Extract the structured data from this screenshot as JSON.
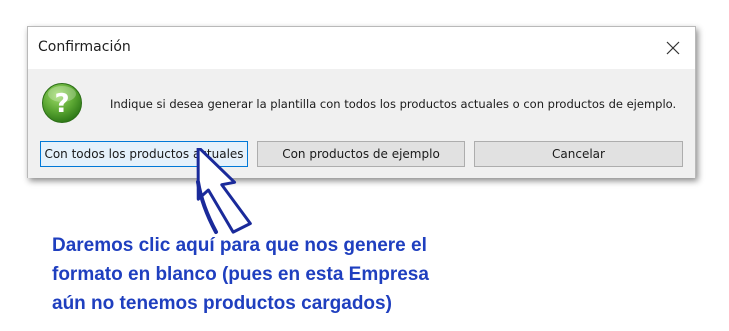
{
  "dialog": {
    "title": "Confirmación",
    "close_icon": "close-icon",
    "question_icon": "question-mark-icon",
    "message": "Indique si desea generar la plantilla con todos los productos actuales o con productos de ejemplo.",
    "buttons": {
      "all_products": "Con todos los productos actuales",
      "example_products": "Con productos de ejemplo",
      "cancel": "Cancelar"
    }
  },
  "annotation": {
    "arrow_icon": "pointer-arrow-icon",
    "lines": [
      "Daremos clic aquí para que nos genere el",
      "formato en blanco (pues en esta Empresa",
      "aún no tenemos productos cargados)"
    ]
  },
  "colors": {
    "annotation_text": "#1f3fbf",
    "icon_green": "#5aa632",
    "default_button_border": "#0078d7"
  }
}
